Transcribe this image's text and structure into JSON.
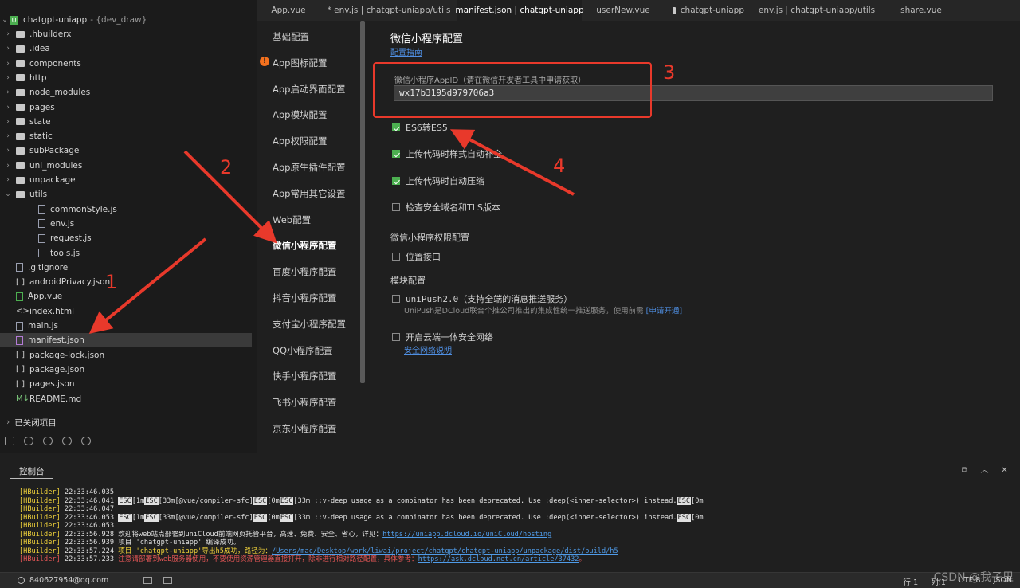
{
  "explorer": {
    "project": {
      "name": "chatgpt-uniapp",
      "suffix": "- {dev_draw}",
      "badge": "U"
    },
    "items": [
      {
        "label": ".hbuilderx",
        "type": "folder"
      },
      {
        "label": ".idea",
        "type": "folder"
      },
      {
        "label": "components",
        "type": "folder"
      },
      {
        "label": "http",
        "type": "folder"
      },
      {
        "label": "node_modules",
        "type": "folder"
      },
      {
        "label": "pages",
        "type": "folder"
      },
      {
        "label": "state",
        "type": "folder"
      },
      {
        "label": "static",
        "type": "folder"
      },
      {
        "label": "subPackage",
        "type": "folder"
      },
      {
        "label": "uni_modules",
        "type": "folder"
      },
      {
        "label": "unpackage",
        "type": "folder"
      },
      {
        "label": "utils",
        "type": "folder-open"
      },
      {
        "label": "commonStyle.js",
        "type": "file"
      },
      {
        "label": "env.js",
        "type": "file"
      },
      {
        "label": "request.js",
        "type": "file"
      },
      {
        "label": "tools.js",
        "type": "file"
      },
      {
        "label": ".gitignore",
        "type": "file"
      },
      {
        "label": "androidPrivacy.json",
        "type": "json"
      },
      {
        "label": "App.vue",
        "type": "vue"
      },
      {
        "label": "index.html",
        "type": "html"
      },
      {
        "label": "main.js",
        "type": "file"
      },
      {
        "label": "manifest.json",
        "type": "manifest"
      },
      {
        "label": "package-lock.json",
        "type": "json"
      },
      {
        "label": "package.json",
        "type": "json"
      },
      {
        "label": "pages.json",
        "type": "json"
      },
      {
        "label": "README.md",
        "type": "md"
      }
    ],
    "closed_projects": "已关闭项目"
  },
  "tabs": [
    {
      "label": "App.vue"
    },
    {
      "label": "* env.js | chatgpt-uniapp/utils"
    },
    {
      "label": "manifest.json | chatgpt-uniapp",
      "active": true
    },
    {
      "label": "userNew.vue"
    },
    {
      "label": "chatgpt-uniapp"
    },
    {
      "label": "env.js | chatgpt-uniapp/utils"
    },
    {
      "label": "share.vue"
    }
  ],
  "manifest_nav": [
    "基础配置",
    "App图标配置",
    "App启动界面配置",
    "App模块配置",
    "App权限配置",
    "App原生插件配置",
    "App常用其它设置",
    "Web配置",
    "微信小程序配置",
    "百度小程序配置",
    "抖音小程序配置",
    "支付宝小程序配置",
    "QQ小程序配置",
    "快手小程序配置",
    "飞书小程序配置",
    "京东小程序配置"
  ],
  "manifest_nav_active": "微信小程序配置",
  "settings": {
    "title": "微信小程序配置",
    "guide_link": "配置指南",
    "appid_label": "微信小程序AppID（请在微信开发者工具中申请获取）",
    "appid_value": "wx17b3195d979706a3",
    "checkboxes": [
      {
        "label": "ES6转ES5",
        "checked": true
      },
      {
        "label": "上传代码时样式自动补全",
        "checked": true
      },
      {
        "label": "上传代码时自动压缩",
        "checked": true
      },
      {
        "label": "检查安全域名和TLS版本",
        "checked": false
      }
    ],
    "perm_section": "微信小程序权限配置",
    "perm_location": {
      "label": "位置接口",
      "checked": false
    },
    "module_section": "模块配置",
    "unipush": {
      "label": "uniPush2.0（支持全端的消息推送服务）",
      "checked": false
    },
    "unipush_desc": "UniPush是DCloud联合个推公司推出的集成性统一推送服务，使用前需",
    "unipush_link": "[申请开通]",
    "cloud_security": {
      "label": "开启云端一体安全网络",
      "checked": false
    },
    "security_link": "安全网络说明"
  },
  "console": {
    "tab": "控制台",
    "lines": [
      {
        "tag": "[HBuilder]",
        "time": "22:33:46.035",
        "parts": []
      },
      {
        "tag": "[HBuilder]",
        "time": "22:33:46.041",
        "parts": [
          {
            "t": "ESC",
            "k": "esc"
          },
          {
            "t": "[1m",
            "k": ""
          },
          {
            "t": "ESC",
            "k": "esc"
          },
          {
            "t": "[33m[@vue/compiler-sfc]",
            "k": ""
          },
          {
            "t": "ESC",
            "k": "esc"
          },
          {
            "t": "[0m",
            "k": ""
          },
          {
            "t": "ESC",
            "k": "esc"
          },
          {
            "t": "[33m ::v-deep usage as a combinator has been deprecated. Use :deep(<inner-selector>) instead.",
            "k": ""
          },
          {
            "t": "ESC",
            "k": "esc"
          },
          {
            "t": "[0m",
            "k": ""
          }
        ]
      },
      {
        "tag": "[HBuilder]",
        "time": "22:33:46.047",
        "parts": []
      },
      {
        "tag": "[HBuilder]",
        "time": "22:33:46.053",
        "parts": [
          {
            "t": "ESC",
            "k": "esc"
          },
          {
            "t": "[1m",
            "k": ""
          },
          {
            "t": "ESC",
            "k": "esc"
          },
          {
            "t": "[33m[@vue/compiler-sfc]",
            "k": ""
          },
          {
            "t": "ESC",
            "k": "esc"
          },
          {
            "t": "[0m",
            "k": ""
          },
          {
            "t": "ESC",
            "k": "esc"
          },
          {
            "t": "[33m ::v-deep usage as a combinator has been deprecated. Use :deep(<inner-selector>) instead.",
            "k": ""
          },
          {
            "t": "ESC",
            "k": "esc"
          },
          {
            "t": "[0m",
            "k": ""
          }
        ]
      },
      {
        "tag": "[HBuilder]",
        "time": "22:33:46.053",
        "parts": []
      },
      {
        "tag": "[HBuilder]",
        "time": "22:33:56.928",
        "parts": [
          {
            "t": "欢迎将web站点部署到uniCloud前端网页托管平台，高速、免费、安全、省心，详见：",
            "k": ""
          },
          {
            "t": "https://uniapp.dcloud.io/uniCloud/hosting",
            "k": "lnk"
          }
        ]
      },
      {
        "tag": "[HBuilder]",
        "time": "22:33:56.939",
        "parts": [
          {
            "t": "项目 'chatgpt-uniapp' 编译成功。",
            "k": ""
          }
        ]
      },
      {
        "tag": "[HBuilder]",
        "time": "22:33:57.224",
        "parts": [
          {
            "t": "项目 'chatgpt-uniapp'导出h5成功，路径为：",
            "k": "ylw"
          },
          {
            "t": "/Users/mac/Desktop/work/liwai/project/chatgpt/chatgpt-uniapp/unpackage/dist/build/h5",
            "k": "lnk"
          }
        ]
      },
      {
        "tag": "[HBuilder]",
        "time": "22:33:57.233",
        "err": true,
        "parts": [
          {
            "t": "注意请部署到web服务器使用，不要使用资源管理器直接打开，除非进行相对路径配置，具体参考：",
            "k": "red"
          },
          {
            "t": "https://ask.dcloud.net.cn/article/37432",
            "k": "lnk"
          },
          {
            "t": "。",
            "k": "red"
          }
        ]
      }
    ]
  },
  "statusbar": {
    "account": "840627954@qq.com",
    "line": "行:1",
    "col": "列:1",
    "encoding": "UTF-8",
    "lang": "JSON"
  },
  "annotations": [
    "1",
    "2",
    "3",
    "4"
  ],
  "watermark": "CSDN @我子里",
  "colors": {
    "accent_red": "#e8392b",
    "link_blue": "#4f8fe3",
    "check_green": "#4caf50"
  }
}
